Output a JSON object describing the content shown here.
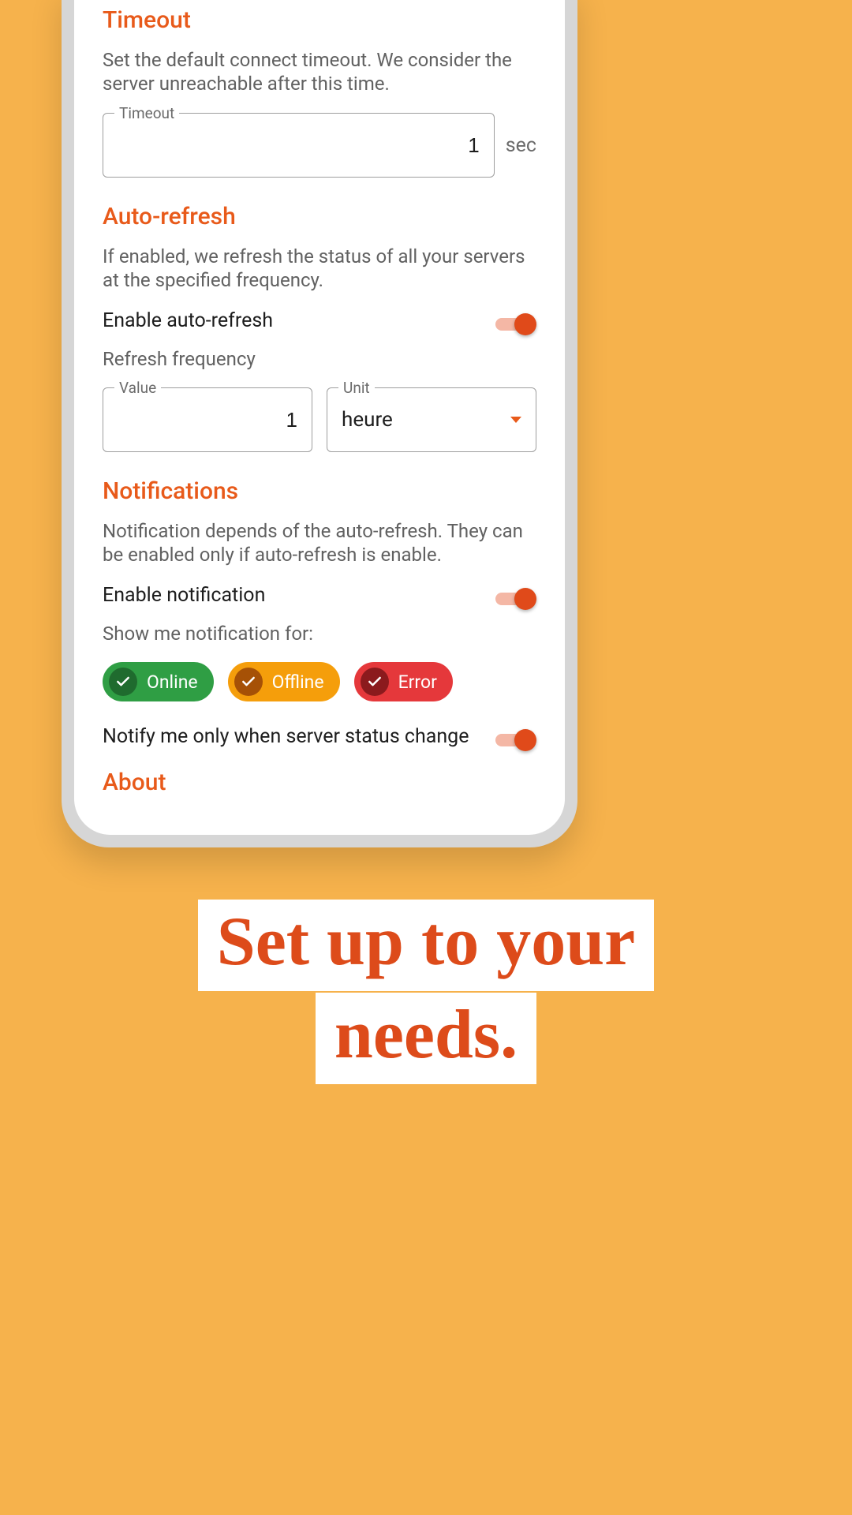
{
  "timeout": {
    "title": "Timeout",
    "desc": "Set the default connect timeout. We consider the server unreachable after this time.",
    "field_label": "Timeout",
    "value": "1",
    "unit_suffix": "sec"
  },
  "autorefresh": {
    "title": "Auto-refresh",
    "desc": "If enabled, we refresh the status of all your servers at the specified frequency.",
    "enable_label": "Enable auto-refresh",
    "freq_label": "Refresh frequency",
    "value_field_label": "Value",
    "value": "1",
    "unit_field_label": "Unit",
    "unit_value": "heure"
  },
  "notifications": {
    "title": "Notifications",
    "desc": "Notification depends of the auto-refresh. They can be enabled only if auto-refresh is enable.",
    "enable_label": "Enable notification",
    "show_for_label": "Show me notification for:",
    "chips": {
      "online": "Online",
      "offline": "Offline",
      "error": "Error"
    },
    "only_change_label": "Notify me only when server status change"
  },
  "about": {
    "title": "About"
  },
  "promo": {
    "line1": "Set up to your",
    "line2": "needs."
  }
}
